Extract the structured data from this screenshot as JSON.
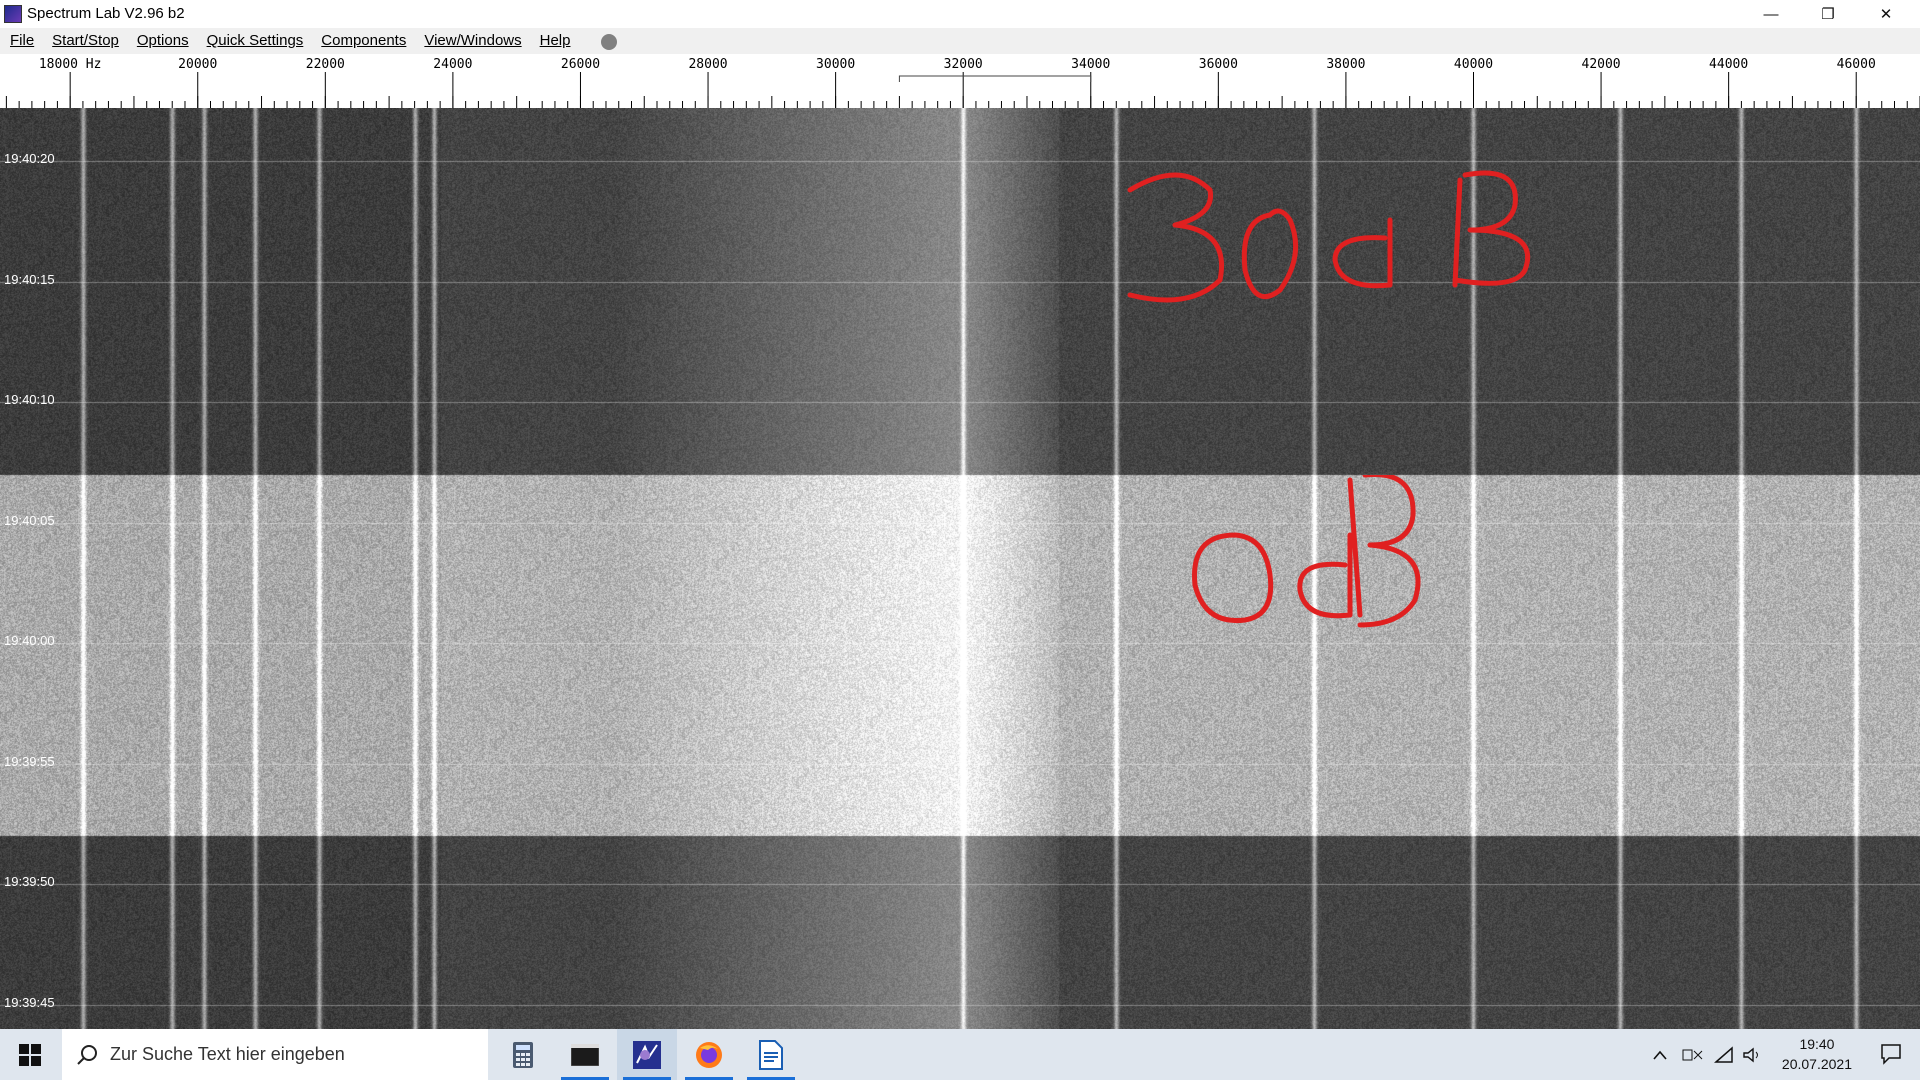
{
  "window": {
    "title": "Spectrum Lab V2.96 b2",
    "minimize_glyph": "—",
    "restore_glyph": "❐",
    "close_glyph": "✕"
  },
  "menu": [
    {
      "label": "File"
    },
    {
      "label": "Start/Stop"
    },
    {
      "label": "Options"
    },
    {
      "label": "Quick Settings"
    },
    {
      "label": "Components"
    },
    {
      "label": "View/Windows"
    },
    {
      "label": "Help"
    }
  ],
  "frequency_axis": {
    "labels": [
      {
        "hz": 18000,
        "text": "18000 Hz"
      },
      {
        "hz": 20000,
        "text": "20000"
      },
      {
        "hz": 22000,
        "text": "22000"
      },
      {
        "hz": 24000,
        "text": "24000"
      },
      {
        "hz": 26000,
        "text": "26000"
      },
      {
        "hz": 28000,
        "text": "28000"
      },
      {
        "hz": 30000,
        "text": "30000"
      },
      {
        "hz": 32000,
        "text": "32000"
      },
      {
        "hz": 34000,
        "text": "34000"
      },
      {
        "hz": 36000,
        "text": "36000"
      },
      {
        "hz": 38000,
        "text": "38000"
      },
      {
        "hz": 40000,
        "text": "40000"
      },
      {
        "hz": 42000,
        "text": "42000"
      },
      {
        "hz": 44000,
        "text": "44000"
      },
      {
        "hz": 46000,
        "text": "46000"
      }
    ],
    "min_hz": 16900,
    "max_hz": 47000
  },
  "waterfall": {
    "time_labels": [
      "19:40:20",
      "19:40:15",
      "19:40:10",
      "19:40:05",
      "19:40:00",
      "19:39:55",
      "19:39:50",
      "19:39:45"
    ],
    "annotations": [
      {
        "text": "30dB",
        "color": "#e02020"
      },
      {
        "text": "0dB",
        "color": "#e02020"
      }
    ],
    "signal_lines_hz": [
      18200,
      19600,
      20100,
      20900,
      21900,
      23400,
      23700,
      32000,
      34400,
      37500,
      40000,
      42300,
      44200,
      46000
    ],
    "bright_band": {
      "start_time": "19:40:07",
      "end_time": "19:39:52"
    }
  },
  "taskbar": {
    "search_placeholder": "Zur Suche Text hier eingeben",
    "apps": [
      {
        "name": "calculator-icon"
      },
      {
        "name": "terminal-icon"
      },
      {
        "name": "spectrum-lab-icon"
      },
      {
        "name": "firefox-icon"
      },
      {
        "name": "writer-icon"
      }
    ],
    "clock_time": "19:40",
    "clock_date": "20.07.2021"
  }
}
